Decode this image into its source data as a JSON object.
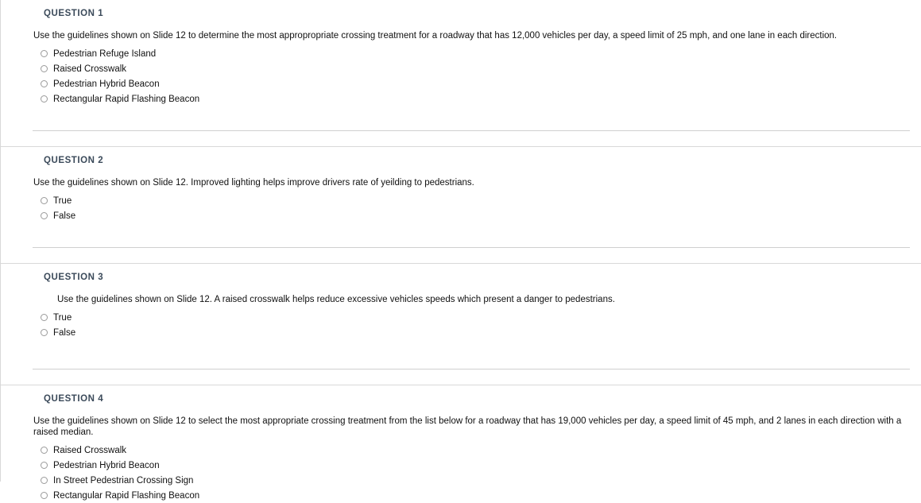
{
  "document": {
    "type": "quiz",
    "questions": [
      {
        "heading": "QUESTION 1",
        "text": "Use the guidelines shown on Slide 12 to determine the most appropropriate crossing treatment for a roadway that has 12,000 vehicles per day, a speed limit of 25 mph, and one lane in each direction.",
        "indented": false,
        "options": [
          {
            "label": "Pedestrian Refuge Island",
            "selected": false
          },
          {
            "label": "Raised Crosswalk",
            "selected": false
          },
          {
            "label": "Pedestrian Hybrid Beacon",
            "selected": false
          },
          {
            "label": "Rectangular Rapid Flashing Beacon",
            "selected": false
          }
        ]
      },
      {
        "heading": "QUESTION 2",
        "text": "Use the guidelines shown on Slide 12. Improved lighting helps improve drivers rate of yeilding to pedestrians.",
        "indented": false,
        "options": [
          {
            "label": "True",
            "selected": false
          },
          {
            "label": "False",
            "selected": false
          }
        ]
      },
      {
        "heading": "QUESTION 3",
        "text": "Use the guidelines shown on Slide 12. A raised crosswalk helps reduce excessive vehicles speeds which present a danger to pedestrians.",
        "indented": true,
        "options": [
          {
            "label": "True",
            "selected": false
          },
          {
            "label": "False",
            "selected": false
          }
        ]
      },
      {
        "heading": "QUESTION 4",
        "text": "Use the guidelines shown on Slide 12 to select the most appropriate crossing treatment from the list below for a roadway that has 19,000 vehicles per day, a speed limit of 45 mph, and 2 lanes in each direction with a raised median.",
        "indented": false,
        "options": [
          {
            "label": "Raised Crosswalk",
            "selected": false
          },
          {
            "label": "Pedestrian Hybrid Beacon",
            "selected": false
          },
          {
            "label": "In Street Pedestrian Crossing Sign",
            "selected": false
          },
          {
            "label": "Rectangular Rapid Flashing Beacon",
            "selected": false
          }
        ]
      }
    ]
  },
  "colors": {
    "heading": "#3b4a5a",
    "body_text": "#111111",
    "rule": "#d9d9d9",
    "radio_border": "#9a9a9a",
    "background": "#ffffff"
  }
}
